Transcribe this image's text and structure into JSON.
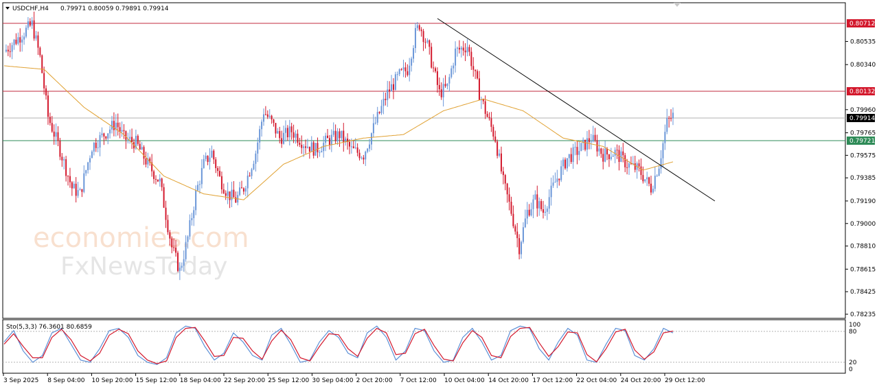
{
  "header": {
    "symbol": "USDCHF,H4",
    "ohlc": "0.79971 0.80059 0.79891 0.79914"
  },
  "watermark": {
    "line1": "economies.com",
    "line2": "FxNewsToday"
  },
  "colors": {
    "bull": "#6a96d8",
    "bear": "#d3182c",
    "ma": "#e0a030",
    "resistance": "#c0283c",
    "support": "#2e8b57",
    "trend": "#000000",
    "stoch_main": "#5b8fd6",
    "stoch_signal": "#d3182c"
  },
  "chart_data": [
    {
      "type": "candlestick",
      "title": "USDCHF,H4",
      "ylim": [
        0.78235,
        0.8085
      ],
      "price_axis_ticks": [
        "0.80535",
        "0.80340",
        "0.79960",
        "0.79765",
        "0.79575",
        "0.79385",
        "0.79190",
        "0.79000",
        "0.78810",
        "0.78615",
        "0.78425",
        "0.78235"
      ],
      "time_axis_labels": [
        "3 Sep 2025",
        "8 Sep 04:00",
        "10 Sep 20:00",
        "15 Sep 12:00",
        "18 Sep 04:00",
        "22 Sep 20:00",
        "25 Sep 12:00",
        "30 Sep 04:00",
        "2 Oct 20:00",
        "7 Oct 12:00",
        "10 Oct 04:00",
        "14 Oct 20:00",
        "17 Oct 12:00",
        "22 Oct 04:00",
        "24 Oct 20:00",
        "29 Oct 12:00"
      ],
      "levels": [
        {
          "name": "resistance-high",
          "value": "0.80712"
        },
        {
          "name": "resistance",
          "value": "0.80132"
        },
        {
          "name": "support",
          "value": "0.79721"
        },
        {
          "name": "current-price",
          "value": "0.79914"
        }
      ],
      "trendline": [
        [
          0.8077,
          0
        ],
        [
          0.7924,
          1
        ]
      ],
      "close_path": [
        [
          0,
          0.8045
        ],
        [
          8,
          0.8058
        ],
        [
          14,
          0.8068
        ],
        [
          18,
          0.804
        ],
        [
          22,
          0.799
        ],
        [
          28,
          0.7962
        ],
        [
          34,
          0.793
        ],
        [
          38,
          0.7925
        ],
        [
          44,
          0.7965
        ],
        [
          50,
          0.7975
        ],
        [
          56,
          0.7985
        ],
        [
          60,
          0.7972
        ],
        [
          66,
          0.7968
        ],
        [
          72,
          0.795
        ],
        [
          78,
          0.7935
        ],
        [
          84,
          0.788
        ],
        [
          88,
          0.786
        ],
        [
          92,
          0.7888
        ],
        [
          96,
          0.7925
        ],
        [
          100,
          0.795
        ],
        [
          104,
          0.796
        ],
        [
          108,
          0.7938
        ],
        [
          112,
          0.7925
        ],
        [
          116,
          0.792
        ],
        [
          120,
          0.793
        ],
        [
          126,
          0.796
        ],
        [
          130,
          0.7995
        ],
        [
          134,
          0.7985
        ],
        [
          138,
          0.7972
        ],
        [
          144,
          0.7978
        ],
        [
          150,
          0.7968
        ],
        [
          156,
          0.7962
        ],
        [
          162,
          0.797
        ],
        [
          168,
          0.7975
        ],
        [
          174,
          0.7962
        ],
        [
          180,
          0.7958
        ],
        [
          186,
          0.7985
        ],
        [
          192,
          0.801
        ],
        [
          198,
          0.8025
        ],
        [
          202,
          0.803
        ],
        [
          206,
          0.806
        ],
        [
          208,
          0.8068
        ],
        [
          212,
          0.805
        ],
        [
          218,
          0.801
        ],
        [
          222,
          0.8015
        ],
        [
          226,
          0.8045
        ],
        [
          232,
          0.805
        ],
        [
          238,
          0.801
        ],
        [
          242,
          0.799
        ],
        [
          246,
          0.7972
        ],
        [
          250,
          0.7935
        ],
        [
          254,
          0.791
        ],
        [
          258,
          0.788
        ],
        [
          262,
          0.791
        ],
        [
          266,
          0.792
        ],
        [
          270,
          0.791
        ],
        [
          276,
          0.7935
        ],
        [
          282,
          0.7955
        ],
        [
          288,
          0.7962
        ],
        [
          294,
          0.7972
        ],
        [
          300,
          0.7958
        ],
        [
          306,
          0.796
        ],
        [
          312,
          0.795
        ],
        [
          318,
          0.7945
        ],
        [
          324,
          0.793
        ],
        [
          328,
          0.795
        ],
        [
          332,
          0.7985
        ],
        [
          335,
          0.7991
        ]
      ],
      "ma_path": [
        [
          0,
          0.8033
        ],
        [
          20,
          0.803
        ],
        [
          40,
          0.7998
        ],
        [
          60,
          0.7975
        ],
        [
          80,
          0.794
        ],
        [
          100,
          0.7925
        ],
        [
          120,
          0.792
        ],
        [
          140,
          0.795
        ],
        [
          160,
          0.7965
        ],
        [
          180,
          0.7972
        ],
        [
          200,
          0.7975
        ],
        [
          220,
          0.7995
        ],
        [
          240,
          0.8005
        ],
        [
          260,
          0.7995
        ],
        [
          280,
          0.7972
        ],
        [
          300,
          0.7965
        ],
        [
          320,
          0.7945
        ],
        [
          335,
          0.7952
        ]
      ]
    },
    {
      "type": "line",
      "title": "Sto(5,3,3) 76.3601 80.6859",
      "ylim": [
        0,
        100
      ],
      "y_ticks": [
        "100",
        "80",
        "20",
        "0"
      ],
      "level_lines": [
        80,
        20
      ],
      "series": [
        {
          "values": [
            60,
            85,
            40,
            15,
            30,
            80,
            90,
            55,
            20,
            15,
            45,
            85,
            90,
            70,
            30,
            15,
            10,
            25,
            80,
            95,
            90,
            50,
            20,
            35,
            80,
            60,
            30,
            20,
            75,
            90,
            55,
            15,
            20,
            60,
            85,
            70,
            35,
            25,
            80,
            95,
            70,
            20,
            40,
            90,
            85,
            40,
            15,
            20,
            70,
            90,
            60,
            20,
            30,
            85,
            95,
            90,
            45,
            20,
            60,
            90,
            75,
            20,
            15,
            55,
            90,
            85,
            30,
            20,
            45,
            90,
            80
          ]
        },
        {
          "values": [
            55,
            78,
            50,
            25,
            25,
            70,
            88,
            65,
            30,
            18,
            35,
            75,
            88,
            78,
            40,
            20,
            12,
            18,
            70,
            90,
            92,
            62,
            28,
            30,
            70,
            68,
            40,
            22,
            62,
            86,
            65,
            25,
            18,
            50,
            78,
            76,
            45,
            28,
            68,
            90,
            80,
            32,
            35,
            78,
            88,
            52,
            22,
            18,
            58,
            85,
            70,
            30,
            25,
            72,
            90,
            92,
            58,
            28,
            50,
            82,
            80,
            32,
            16,
            45,
            82,
            88,
            42,
            22,
            38,
            80,
            84
          ]
        }
      ]
    }
  ]
}
